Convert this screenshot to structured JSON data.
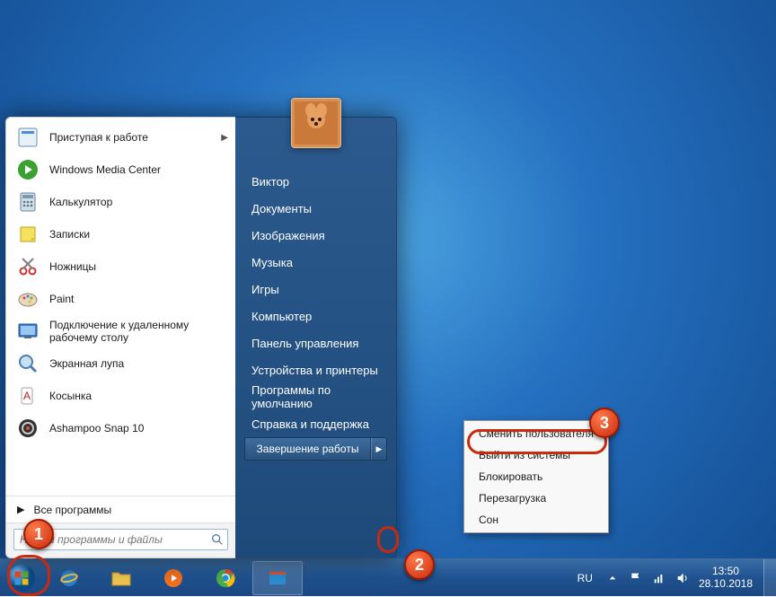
{
  "startmenu": {
    "items": [
      {
        "label": "Приступая к работе",
        "icon": "getting-started",
        "hasArrow": true
      },
      {
        "label": "Windows Media Center",
        "icon": "wmc"
      },
      {
        "label": "Калькулятор",
        "icon": "calc"
      },
      {
        "label": "Записки",
        "icon": "sticky"
      },
      {
        "label": "Ножницы",
        "icon": "snip"
      },
      {
        "label": "Paint",
        "icon": "paint"
      },
      {
        "label": "Подключение к удаленному рабочему столу",
        "icon": "rdp"
      },
      {
        "label": "Экранная лупа",
        "icon": "magnifier"
      },
      {
        "label": "Косынка",
        "icon": "solitaire"
      },
      {
        "label": "Ashampoo Snap 10",
        "icon": "ashampoo"
      }
    ],
    "all_programs": "Все программы",
    "search_placeholder": "Найти программы и файлы",
    "right": [
      "Виктор",
      "Документы",
      "Изображения",
      "Музыка",
      "Игры",
      "Компьютер",
      "Панель управления",
      "Устройства и принтеры",
      "Программы по умолчанию",
      "Справка и поддержка"
    ],
    "shutdown_label": "Завершение работы"
  },
  "submenu": [
    "Сменить пользователя",
    "Выйти из системы",
    "Блокировать",
    "Перезагрузка",
    "Сон"
  ],
  "tray": {
    "lang": "RU",
    "time": "13:50",
    "date": "28.10.2018"
  },
  "callouts": {
    "1": "1",
    "2": "2",
    "3": "3"
  }
}
